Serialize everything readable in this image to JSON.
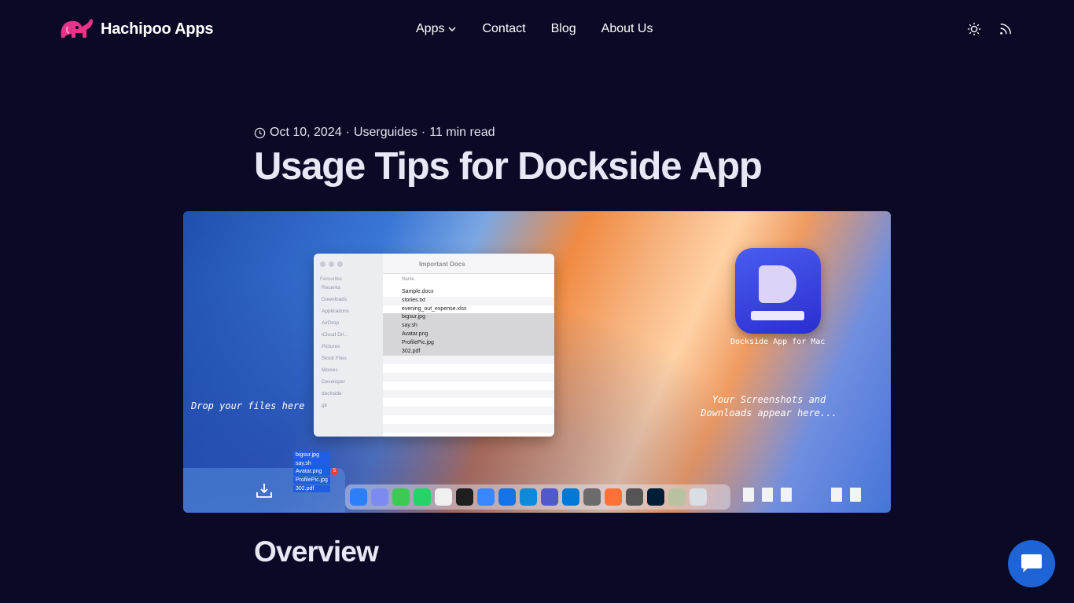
{
  "header": {
    "logo_text": "Hachipoo Apps",
    "nav": [
      {
        "label": "Apps",
        "has_dropdown": true
      },
      {
        "label": "Contact"
      },
      {
        "label": "Blog"
      },
      {
        "label": "About Us"
      }
    ],
    "icons": [
      "sun-icon",
      "rss-icon"
    ]
  },
  "post": {
    "date": "Oct 10, 2024",
    "separator": "·",
    "category": "Userguides",
    "read_time": "11 min read",
    "title": "Usage Tips for Dockside App"
  },
  "hero": {
    "finder_title": "Important Docs",
    "sidebar_title": "Favourites",
    "sidebar_items": [
      "Recents",
      "Downloads",
      "Applications",
      "AirDrop",
      "iCloud Dri...",
      "Pictures",
      "Stock Files",
      "Movies",
      "Developer",
      "dockside",
      "git"
    ],
    "column_header": "Name",
    "files": [
      "Sample.docx",
      "stories.txt",
      "evening_out_expense.xlsx",
      "bigsur.jpg",
      "say.sh",
      "Avatar.png",
      "ProfilePic.jpg",
      "302.pdf"
    ],
    "selected_files": [
      "bigsur.jpg",
      "say.sh",
      "Avatar.png",
      "ProfilePic.jpg",
      "302.pdf"
    ],
    "app_label": "Dockside App for Mac",
    "drop_hint": "Drop your files here",
    "screens_hint": "Your Screenshots and Downloads appear here...",
    "drag_badge": "5"
  },
  "section": {
    "title": "Overview"
  },
  "colors": {
    "background": "#0b0a26",
    "logo_pink": "#e7338a",
    "chat_blue": "#1f64d6"
  }
}
